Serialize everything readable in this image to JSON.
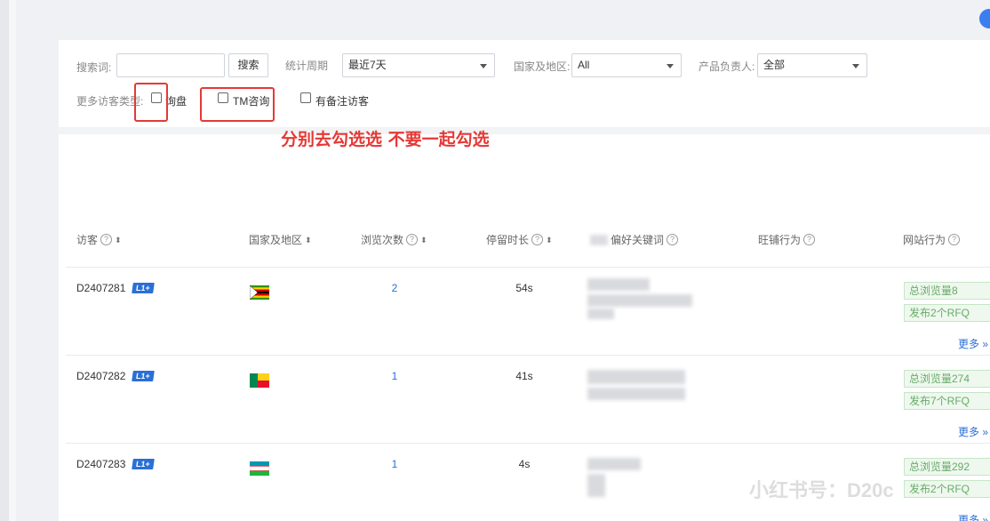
{
  "filters": {
    "search_label": "搜索词:",
    "search_value": "",
    "search_button": "搜索",
    "period_label": "统计周期",
    "period_value": "最近7天",
    "country_label": "国家及地区:",
    "country_value": "All",
    "owner_label": "产品负责人:",
    "owner_value": "全部",
    "more_types_label": "更多访客类型:",
    "checkboxes": [
      {
        "label": "询盘",
        "checked": false
      },
      {
        "label": "TM咨询",
        "checked": false
      },
      {
        "label": "有备注访客",
        "checked": false
      }
    ]
  },
  "annotation": {
    "text": "分别去勾选选 不要一起勾选",
    "color": "#e53935"
  },
  "table": {
    "headers": [
      "访客",
      "国家及地区",
      "浏览次数",
      "停留时长",
      "偏好关键词",
      "旺铺行为",
      "网站行为"
    ],
    "rows": [
      {
        "id": "D2407281",
        "level": "L1+",
        "flag": "zimbabwe-flag",
        "visits": "2",
        "duration": "54s",
        "tags": [
          "总浏览量8",
          "发布2个RFQ"
        ],
        "more": "更多"
      },
      {
        "id": "D2407282",
        "level": "L1+",
        "flag": "benin-flag",
        "visits": "1",
        "duration": "41s",
        "tags": [
          "总浏览量274",
          "发布7个RFQ"
        ],
        "more": "更多"
      },
      {
        "id": "D2407283",
        "level": "L1+",
        "flag": "uzbekistan-flag",
        "visits": "1",
        "duration": "4s",
        "tags": [
          "总浏览量292",
          "发布2个RFQ"
        ],
        "more": "更多"
      }
    ]
  },
  "watermark": "小红书号：D20c",
  "colors": {
    "accent": "#2b6fd6",
    "tag_green": "#6aaa6a",
    "annotation_red": "#e53935"
  }
}
